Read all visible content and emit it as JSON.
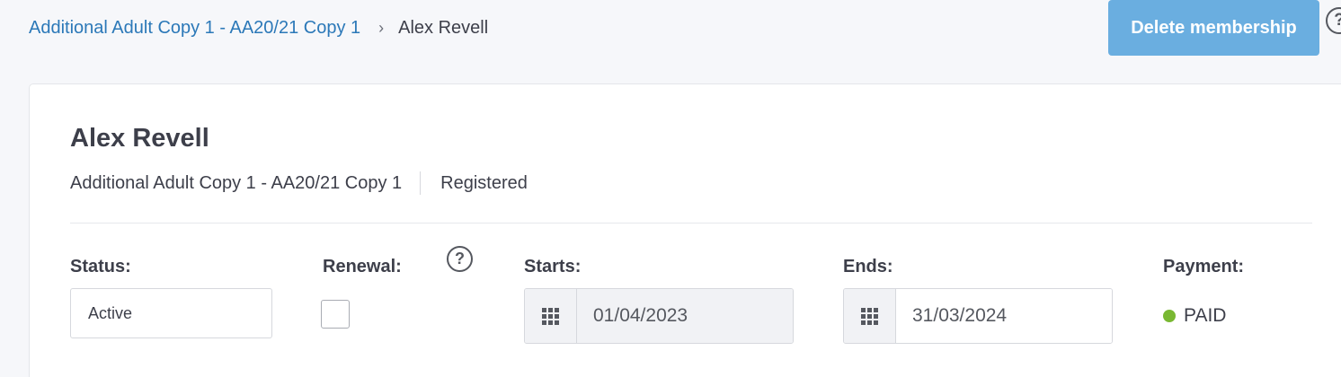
{
  "breadcrumb": {
    "parent": "Additional Adult Copy 1 - AA20/21 Copy 1",
    "separator": "›",
    "current": "Alex Revell"
  },
  "header": {
    "delete_label": "Delete membership",
    "help_glyph": "?"
  },
  "member": {
    "name": "Alex Revell",
    "membership": "Additional Adult Copy 1 - AA20/21 Copy 1",
    "registration": "Registered"
  },
  "fields": {
    "status_label": "Status:",
    "status_value": "Active",
    "renewal_label": "Renewal:",
    "renewal_checked": false,
    "renewal_help_glyph": "?",
    "starts_label": "Starts:",
    "starts_value": "01/04/2023",
    "ends_label": "Ends:",
    "ends_value": "31/03/2024",
    "payment_label": "Payment:",
    "payment_value": "PAID"
  },
  "icons": {
    "calendar": "grid-icon",
    "help": "question-circle-icon",
    "paid_status": "status-dot-icon"
  },
  "colors": {
    "link": "#2b78b8",
    "delete_button": "#6aaee0",
    "paid": "#79b832"
  }
}
